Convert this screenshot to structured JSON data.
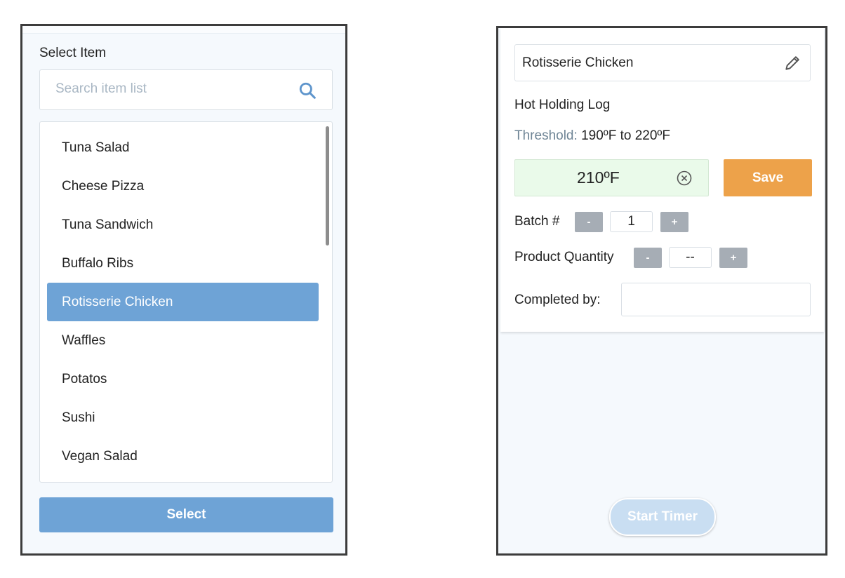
{
  "left_panel": {
    "title": "Select Item",
    "search": {
      "placeholder": "Search item list"
    },
    "items": [
      {
        "label": "Tuna Salad"
      },
      {
        "label": "Cheese Pizza"
      },
      {
        "label": "Tuna Sandwich"
      },
      {
        "label": "Buffalo Ribs"
      },
      {
        "label": "Rotisserie Chicken"
      },
      {
        "label": "Waffles"
      },
      {
        "label": "Potatos"
      },
      {
        "label": "Sushi"
      },
      {
        "label": "Vegan Salad"
      }
    ],
    "selected_item": "Rotisserie Chicken",
    "select_label": "Select"
  },
  "right_panel": {
    "item_name": "Rotisserie Chicken",
    "log_title": "Hot Holding Log",
    "threshold_label": "Threshold:",
    "threshold_value": "190ºF to 220ºF",
    "temperature": "210ºF",
    "save_label": "Save",
    "batch": {
      "label": "Batch #",
      "minus": "-",
      "value": "1",
      "plus": "+"
    },
    "product_quantity": {
      "label": "Product Quantity",
      "minus": "-",
      "value": "--",
      "plus": "+"
    },
    "completed_by": {
      "label": "Completed by:",
      "value": ""
    },
    "start_timer_label": "Start Timer"
  },
  "icons": {
    "search": "search-icon",
    "edit": "pencil-icon",
    "clear": "clear-circle-icon"
  },
  "colors": {
    "selected_item_bg": "#6ea3d6",
    "select_button": "#6ea3d6",
    "save_button": "#eda24a",
    "temperature_ok_bg": "#eafaea",
    "stepper_button": "#a6adb5",
    "start_timer_disabled": "#c9def2"
  }
}
